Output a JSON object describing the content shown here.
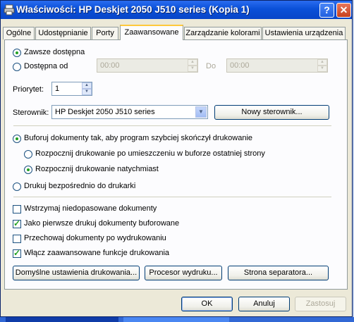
{
  "window": {
    "title": "Właściwości: HP Deskjet 2050 J510 series (Kopia 1)",
    "help_label": "?",
    "close_label": "✕"
  },
  "tabs": [
    {
      "label": "Ogólne"
    },
    {
      "label": "Udostępnianie"
    },
    {
      "label": "Porty"
    },
    {
      "label": "Zaawansowane"
    },
    {
      "label": "Zarządzanie kolorami"
    },
    {
      "label": "Ustawienia urządzenia"
    }
  ],
  "availability": {
    "always_label": "Zawsze dostępna",
    "from_label": "Dostępna od",
    "from_time": "00:00",
    "to_label": "Do",
    "to_time": "00:00"
  },
  "priority": {
    "label": "Priorytet:",
    "value": "1"
  },
  "driver": {
    "label": "Sterownik:",
    "selected": "HP Deskjet 2050 J510 series",
    "new_button": "Nowy sterownik..."
  },
  "spool": {
    "spool_label": "Buforuj dokumenty tak, aby program szybciej skończył drukowanie",
    "after_last_page_label": "Rozpocznij drukowanie po umieszczeniu w buforze ostatniej strony",
    "immediately_label": "Rozpocznij drukowanie natychmiast",
    "direct_label": "Drukuj bezpośrednio do drukarki"
  },
  "options": [
    {
      "label": "Wstrzymaj niedopasowane dokumenty",
      "checked": false
    },
    {
      "label": "Jako pierwsze drukuj dokumenty buforowane",
      "checked": true
    },
    {
      "label": "Przechowaj dokumenty po wydrukowaniu",
      "checked": false
    },
    {
      "label": "Włącz zaawansowane funkcje drukowania",
      "checked": true
    }
  ],
  "buttons": {
    "defaults": "Domyślne ustawienia drukowania...",
    "processor": "Procesor wydruku...",
    "separator": "Strona separatora...",
    "ok": "OK",
    "cancel": "Anuluj",
    "apply": "Zastosuj"
  }
}
